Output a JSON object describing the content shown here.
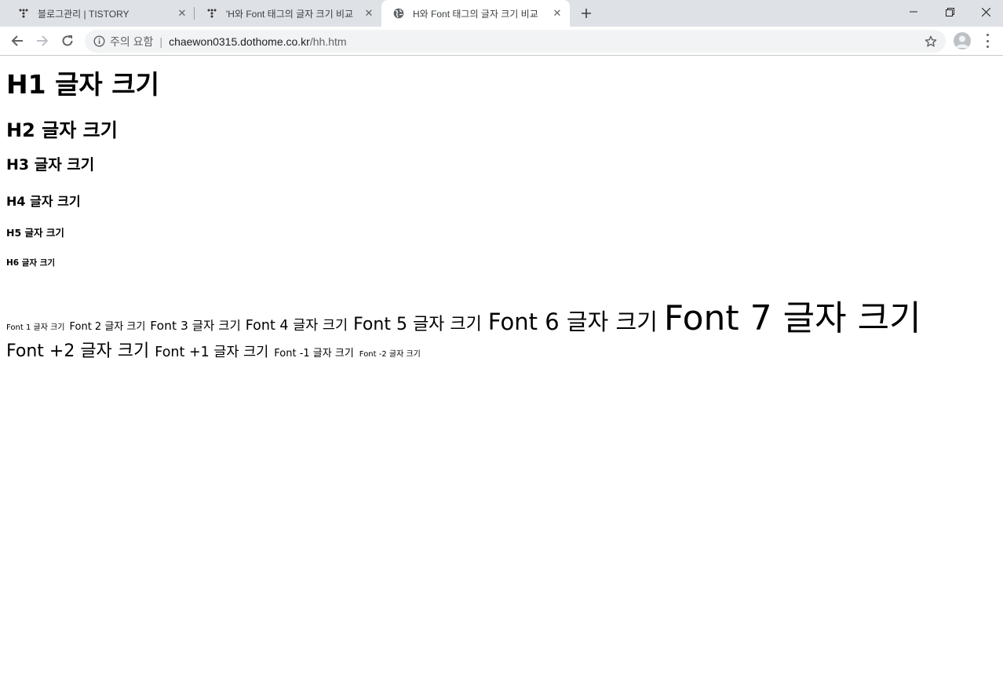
{
  "browser": {
    "tabs": [
      {
        "label": "블로그관리 | TISTORY",
        "favicon": "tistory-icon",
        "active": false
      },
      {
        "label": "'H와 Font 태그의 글자 크기 비교",
        "favicon": "tistory-icon",
        "active": false
      },
      {
        "label": "H와 Font 태그의 글자 크기 비교",
        "favicon": "globe-icon",
        "active": true
      }
    ],
    "security_label": "주의 요함",
    "url_host": "chaewon0315.dothome.co.kr",
    "url_path": "/hh.htm",
    "colors": {
      "tabstrip": "#dee1e6",
      "omnibox": "#f1f3f4"
    }
  },
  "page": {
    "headings": {
      "h1": "H1 글자 크기",
      "h2": "H2 글자 크기",
      "h3": "H3 글자 크기",
      "h4": "H4 글자 크기",
      "h5": "H5 글자 크기",
      "h6": "H6 글자 크기"
    },
    "fonts_absolute": [
      "Font 1 글자 크기",
      "Font 2 글자 크기",
      "Font 3 글자 크기",
      "Font 4 글자 크기",
      "Font 5 글자 크기",
      "Font 6 글자 크기",
      "Font 7 글자 크기"
    ],
    "fonts_relative": [
      "Font +2 글자 크기",
      "Font +1 글자 크기",
      "Font -1 글자 크기",
      "Font -2 글자 크기"
    ]
  }
}
